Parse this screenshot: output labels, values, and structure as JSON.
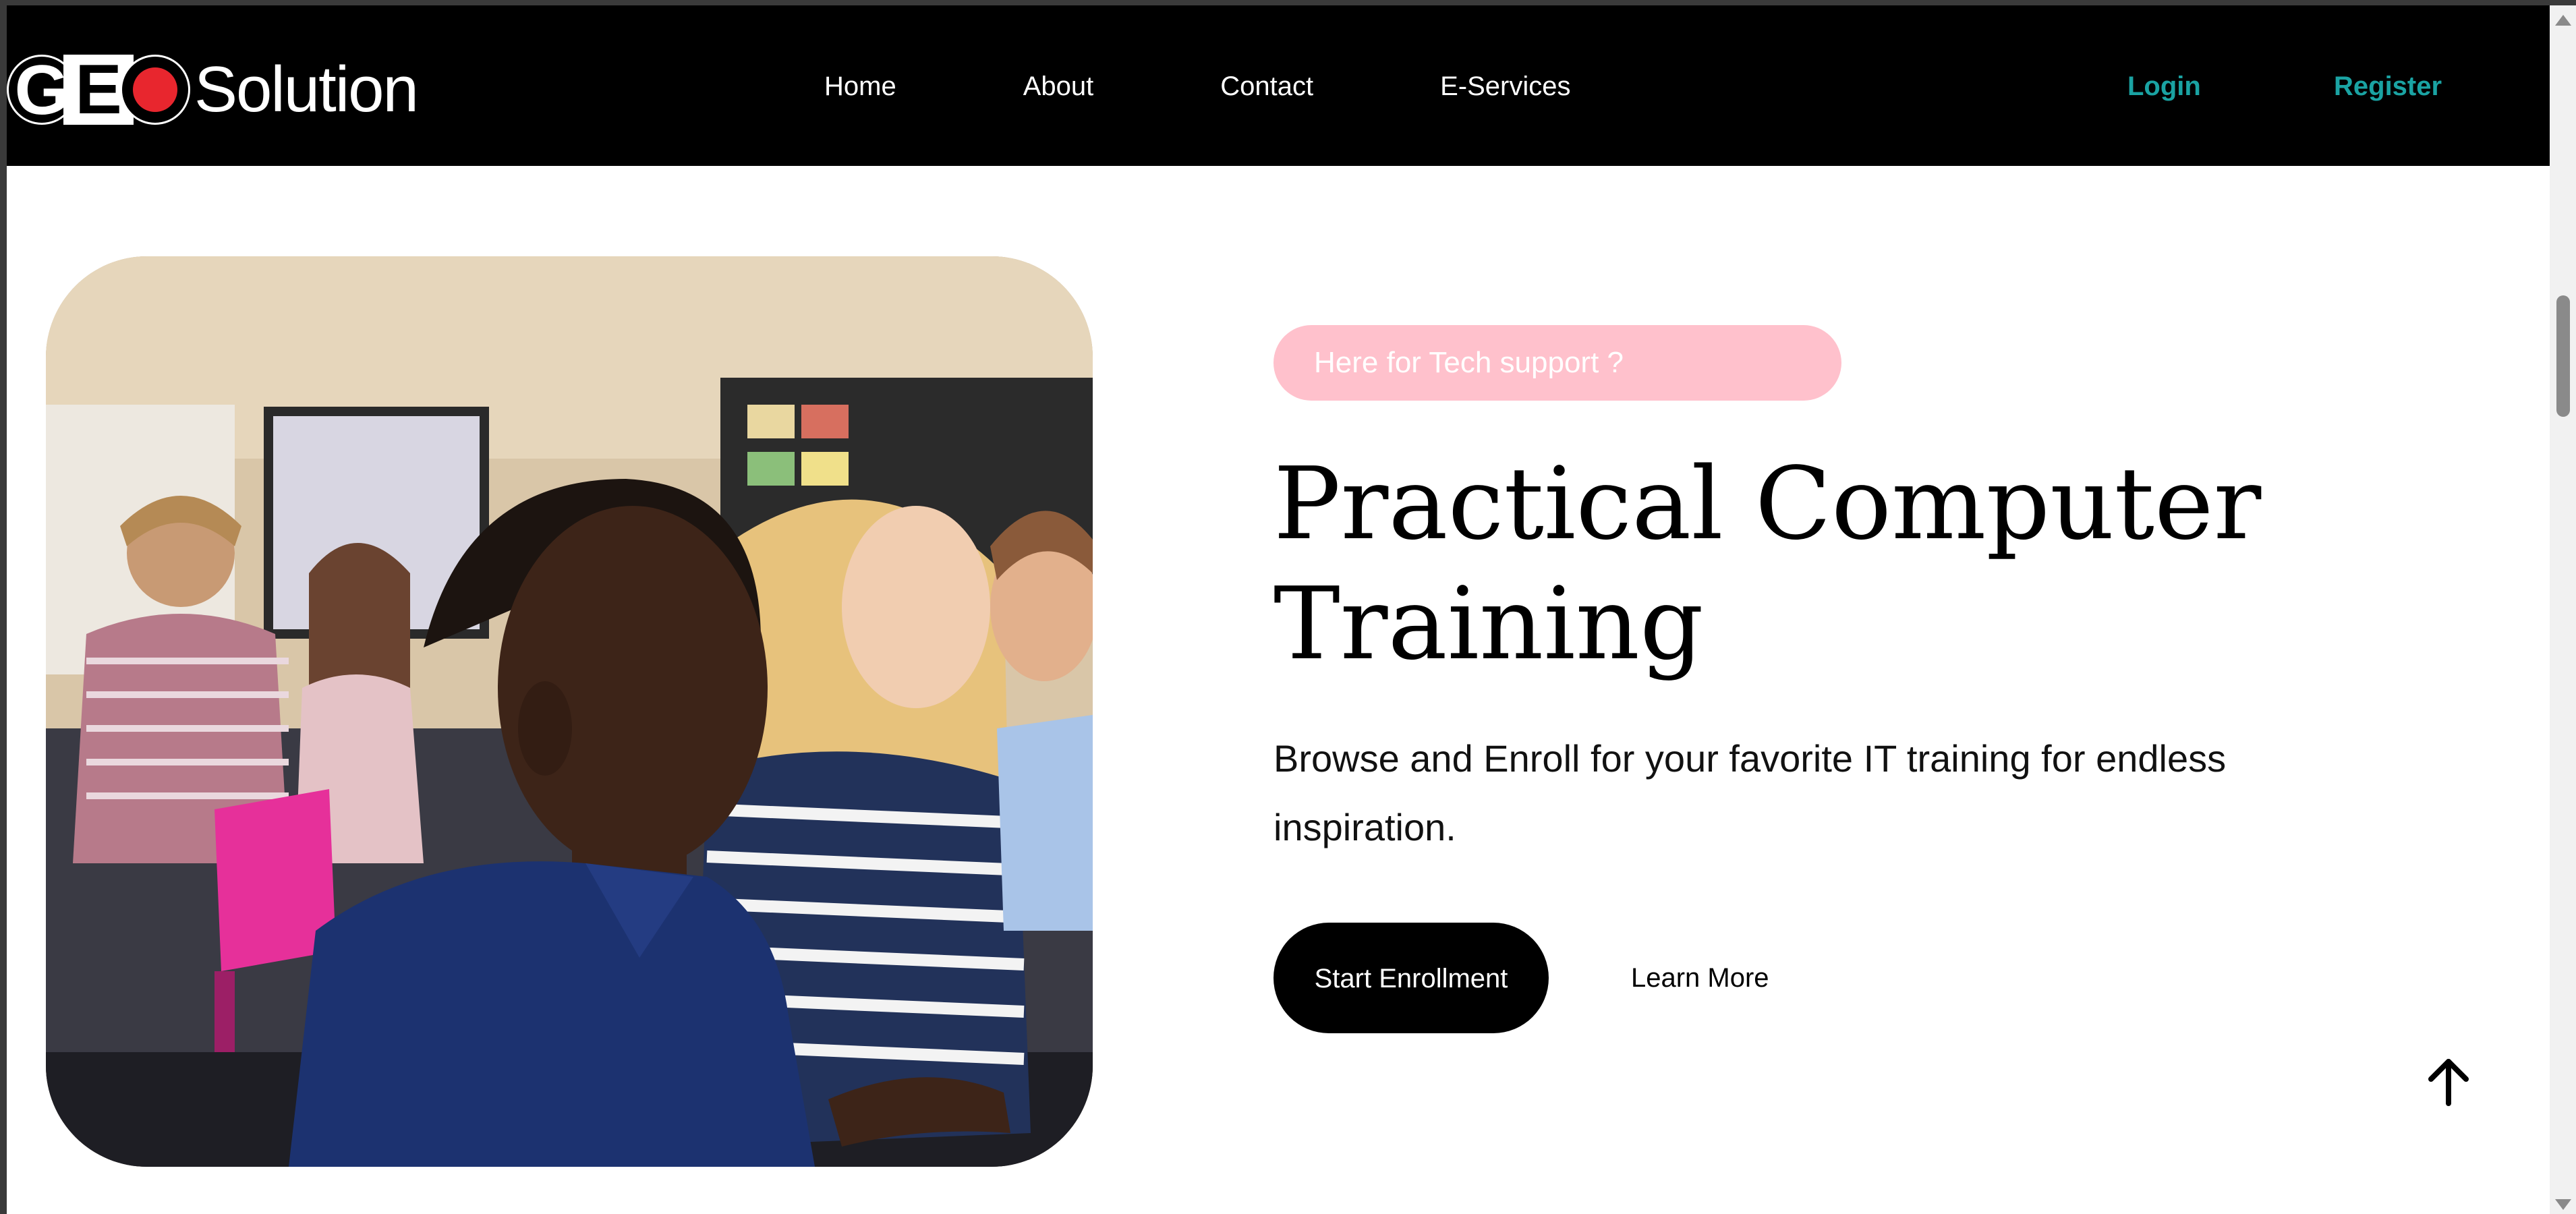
{
  "brand": {
    "logo_text": "GEOSolution",
    "logo_mark": "GEO",
    "logo_word": "Solution"
  },
  "nav": {
    "links": [
      "Home",
      "About",
      "Contact",
      "E-Services"
    ],
    "login": "Login",
    "register": "Register"
  },
  "hero": {
    "badge": "Here for Tech support ?",
    "title_line1": "Practical Computer",
    "title_line2": "Training",
    "description": "Browse and Enroll for your favorite IT training for endless inspiration.",
    "primary_button": "Start Enrollment",
    "secondary_link": "Learn More",
    "image_icon": "classroom-photo"
  },
  "icons": {
    "back_to_top": "arrow-up-icon"
  },
  "colors": {
    "navbar_bg": "#000000",
    "auth_accent": "#1aa3a3",
    "badge_bg": "#ffc1cc",
    "logo_red": "#e8262e",
    "button_bg": "#000000"
  }
}
